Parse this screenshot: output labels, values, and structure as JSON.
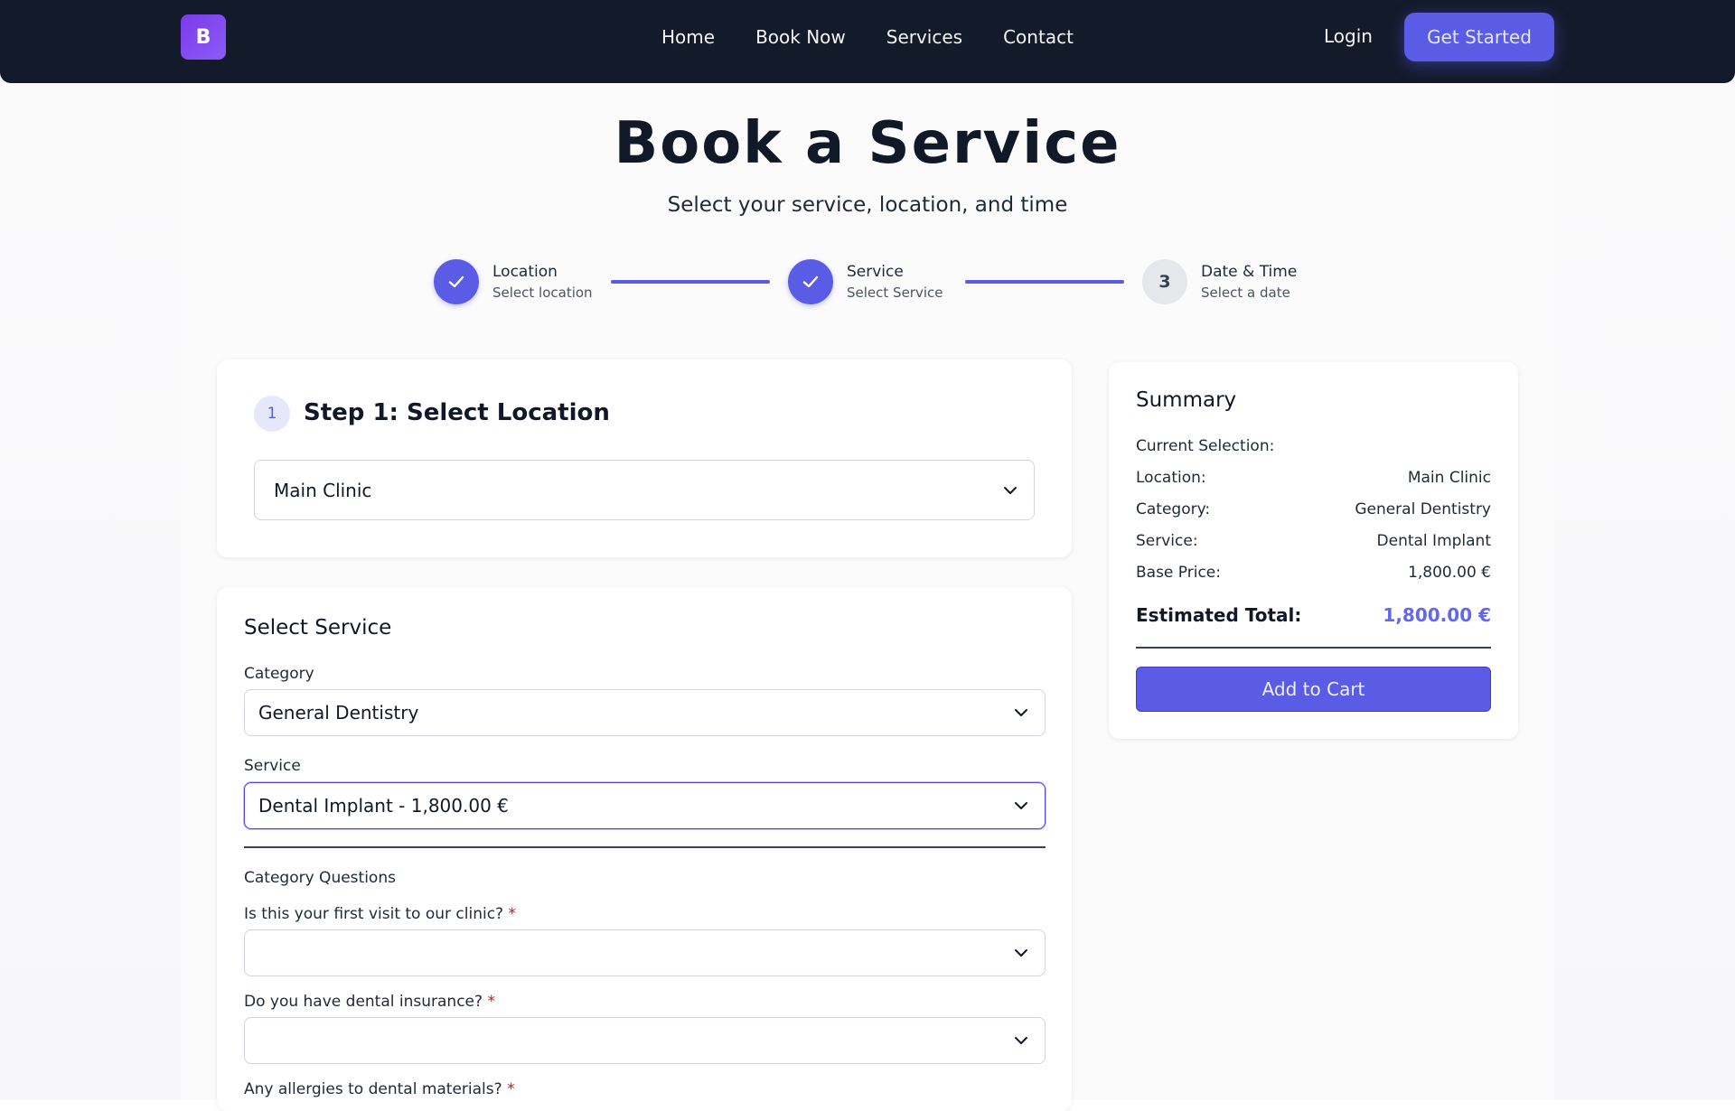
{
  "nav": {
    "logo_letter": "B",
    "links": [
      "Home",
      "Book Now",
      "Services",
      "Contact"
    ],
    "login": "Login",
    "cta": "Get Started"
  },
  "hero": {
    "title": "Book a Service",
    "subtitle": "Select your service, location, and time"
  },
  "stepper": [
    {
      "title": "Location",
      "subtitle": "Select location",
      "state": "done"
    },
    {
      "title": "Service",
      "subtitle": "Select Service",
      "state": "done"
    },
    {
      "number": "3",
      "title": "Date & Time",
      "subtitle": "Select a date",
      "state": "todo"
    }
  ],
  "location_card": {
    "badge": "1",
    "heading": "Step 1: Select Location",
    "selected_location": "Main Clinic"
  },
  "service_card": {
    "heading": "Select Service",
    "category_label": "Category",
    "category_value": "General Dentistry",
    "service_label": "Service",
    "service_value": "Dental Implant - 1,800.00 €",
    "questions_title": "Category Questions",
    "questions": [
      {
        "label": "Is this your first visit to our clinic?",
        "required_mark": "*",
        "value": ""
      },
      {
        "label": "Do you have dental insurance?",
        "required_mark": "*",
        "value": ""
      },
      {
        "label": "Any allergies to dental materials?",
        "required_mark": "*",
        "value": ""
      }
    ]
  },
  "summary": {
    "heading": "Summary",
    "current_selection_label": "Current Selection:",
    "rows": [
      {
        "label": "Location:",
        "value": "Main Clinic"
      },
      {
        "label": "Category:",
        "value": "General Dentistry"
      },
      {
        "label": "Service:",
        "value": "Dental Implant"
      },
      {
        "label": "Base Price:",
        "value": "1,800.00 €"
      }
    ],
    "total_label": "Estimated Total:",
    "total_value": "1,800.00 €",
    "add_to_cart": "Add to Cart"
  },
  "colors": {
    "primary": "#5b5ce6",
    "navbar": "#131a2a",
    "required": "#b91c1c"
  },
  "icons": [
    "check-icon",
    "chevron-down-icon"
  ]
}
